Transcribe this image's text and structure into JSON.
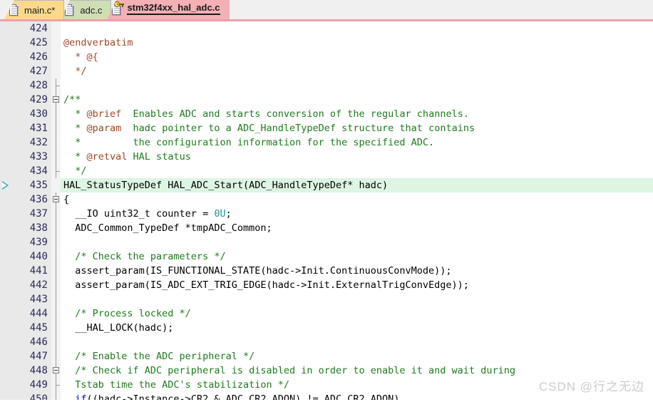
{
  "tabs": [
    {
      "label": "main.c*",
      "icon": "document-icon",
      "state": "modified",
      "color": "#fcd98a",
      "active": false,
      "readonly": false
    },
    {
      "label": "adc.c",
      "icon": "document-icon",
      "state": "saved",
      "color": "#cfdfb4",
      "active": false,
      "readonly": false
    },
    {
      "label": "stm32f4xx_hal_adc.c",
      "icon": "document-key-icon",
      "state": "read-only",
      "color": "#f3b0b5",
      "active": true,
      "readonly": true
    }
  ],
  "editor": {
    "first_line": 424,
    "last_line": 450,
    "highlighted_line": 435,
    "marker_line": 435,
    "marker_icon": "execution-arrow-icon",
    "lines": [
      {
        "num": "424",
        "fold": "none",
        "marker": false,
        "hl": false,
        "tokens": []
      },
      {
        "num": "425",
        "fold": "none",
        "marker": false,
        "hl": false,
        "tokens": [
          {
            "t": "@endverbatim",
            "c": "dox"
          }
        ]
      },
      {
        "num": "426",
        "fold": "none",
        "marker": false,
        "hl": false,
        "tokens": [
          {
            "t": "  * ",
            "c": "dox"
          },
          {
            "t": "@{",
            "c": "dox"
          }
        ]
      },
      {
        "num": "427",
        "fold": "none",
        "marker": false,
        "hl": false,
        "tokens": [
          {
            "t": "  */",
            "c": "dox"
          }
        ]
      },
      {
        "num": "428",
        "fold": "tick",
        "marker": false,
        "hl": false,
        "tokens": []
      },
      {
        "num": "429",
        "fold": "box",
        "marker": false,
        "hl": false,
        "tokens": [
          {
            "t": "/**",
            "c": "cmt"
          }
        ]
      },
      {
        "num": "430",
        "fold": "line",
        "marker": false,
        "hl": false,
        "tokens": [
          {
            "t": "  * ",
            "c": "cmt"
          },
          {
            "t": "@brief",
            "c": "dox"
          },
          {
            "t": "  Enables ADC and starts conversion of the regular channels.",
            "c": "cmt"
          }
        ]
      },
      {
        "num": "431",
        "fold": "line",
        "marker": false,
        "hl": false,
        "tokens": [
          {
            "t": "  * ",
            "c": "cmt"
          },
          {
            "t": "@param",
            "c": "dox"
          },
          {
            "t": "  hadc pointer to a ADC_HandleTypeDef structure that contains",
            "c": "cmt"
          }
        ]
      },
      {
        "num": "432",
        "fold": "line",
        "marker": false,
        "hl": false,
        "tokens": [
          {
            "t": "  * ",
            "c": "cmt"
          },
          {
            "t": "        the configuration information for the specified ADC.",
            "c": "cmt"
          }
        ]
      },
      {
        "num": "433",
        "fold": "line",
        "marker": false,
        "hl": false,
        "tokens": [
          {
            "t": "  * ",
            "c": "cmt"
          },
          {
            "t": "@retval",
            "c": "dox"
          },
          {
            "t": " HAL status",
            "c": "cmt"
          }
        ]
      },
      {
        "num": "434",
        "fold": "tick",
        "marker": false,
        "hl": false,
        "tokens": [
          {
            "t": "  */",
            "c": "cmt"
          }
        ]
      },
      {
        "num": "435",
        "fold": "none",
        "marker": true,
        "hl": true,
        "tokens": [
          {
            "t": "HAL_StatusTypeDef HAL_ADC_Start(ADC_HandleTypeDef* hadc)",
            "c": ""
          }
        ]
      },
      {
        "num": "436",
        "fold": "box",
        "marker": false,
        "hl": false,
        "tokens": [
          {
            "t": "{",
            "c": ""
          }
        ]
      },
      {
        "num": "437",
        "fold": "line",
        "marker": false,
        "hl": false,
        "tokens": [
          {
            "t": "  __IO uint32_t counter = ",
            "c": ""
          },
          {
            "t": "0U",
            "c": "num"
          },
          {
            "t": ";",
            "c": ""
          }
        ]
      },
      {
        "num": "438",
        "fold": "line",
        "marker": false,
        "hl": false,
        "tokens": [
          {
            "t": "  ADC_Common_TypeDef *tmpADC_Common;",
            "c": ""
          }
        ]
      },
      {
        "num": "439",
        "fold": "line",
        "marker": false,
        "hl": false,
        "tokens": []
      },
      {
        "num": "440",
        "fold": "line",
        "marker": false,
        "hl": false,
        "tokens": [
          {
            "t": "  /* Check the parameters */",
            "c": "cmt"
          }
        ]
      },
      {
        "num": "441",
        "fold": "line",
        "marker": false,
        "hl": false,
        "tokens": [
          {
            "t": "  assert_param(IS_FUNCTIONAL_STATE(hadc->Init.ContinuousConvMode));",
            "c": ""
          }
        ]
      },
      {
        "num": "442",
        "fold": "line",
        "marker": false,
        "hl": false,
        "tokens": [
          {
            "t": "  assert_param(IS_ADC_EXT_TRIG_EDGE(hadc->Init.ExternalTrigConvEdge));",
            "c": ""
          }
        ]
      },
      {
        "num": "443",
        "fold": "line",
        "marker": false,
        "hl": false,
        "tokens": []
      },
      {
        "num": "444",
        "fold": "line",
        "marker": false,
        "hl": false,
        "tokens": [
          {
            "t": "  /* Process locked */",
            "c": "cmt"
          }
        ]
      },
      {
        "num": "445",
        "fold": "line",
        "marker": false,
        "hl": false,
        "tokens": [
          {
            "t": "  __HAL_LOCK(hadc);",
            "c": ""
          }
        ]
      },
      {
        "num": "446",
        "fold": "line",
        "marker": false,
        "hl": false,
        "tokens": []
      },
      {
        "num": "447",
        "fold": "line",
        "marker": false,
        "hl": false,
        "tokens": [
          {
            "t": "  /* Enable the ADC peripheral */",
            "c": "cmt"
          }
        ]
      },
      {
        "num": "448",
        "fold": "box",
        "marker": false,
        "hl": false,
        "tokens": [
          {
            "t": "  /* Check if ADC peripheral is disabled in order to enable it and wait during",
            "c": "cmt"
          }
        ]
      },
      {
        "num": "449",
        "fold": "tick",
        "marker": false,
        "hl": false,
        "tokens": [
          {
            "t": "  Tstab time the ADC's stabilization */",
            "c": "cmt"
          }
        ]
      },
      {
        "num": "450",
        "fold": "line",
        "marker": false,
        "hl": false,
        "tokens": [
          {
            "t": "  if",
            "c": "kw"
          },
          {
            "t": "((hadc->Instance->CR2 & ADC_CR2_ADON) != ADC_CR2_ADON)",
            "c": ""
          }
        ]
      }
    ]
  },
  "watermark": {
    "text": "CSDN @行之无边"
  },
  "colors": {
    "tab_active": "#f3b0b5",
    "tab_modified": "#fcd98a",
    "tab_saved": "#cfdfb4",
    "highlight_line": "#ddf5e2",
    "gutter": "#e9e9e9",
    "comment": "#1f7a1f",
    "doxygen_tag": "#9c4a2a",
    "number_literal": "#1a9b9b",
    "keyword": "#0000d0",
    "line_number": "#2b2b5a"
  }
}
